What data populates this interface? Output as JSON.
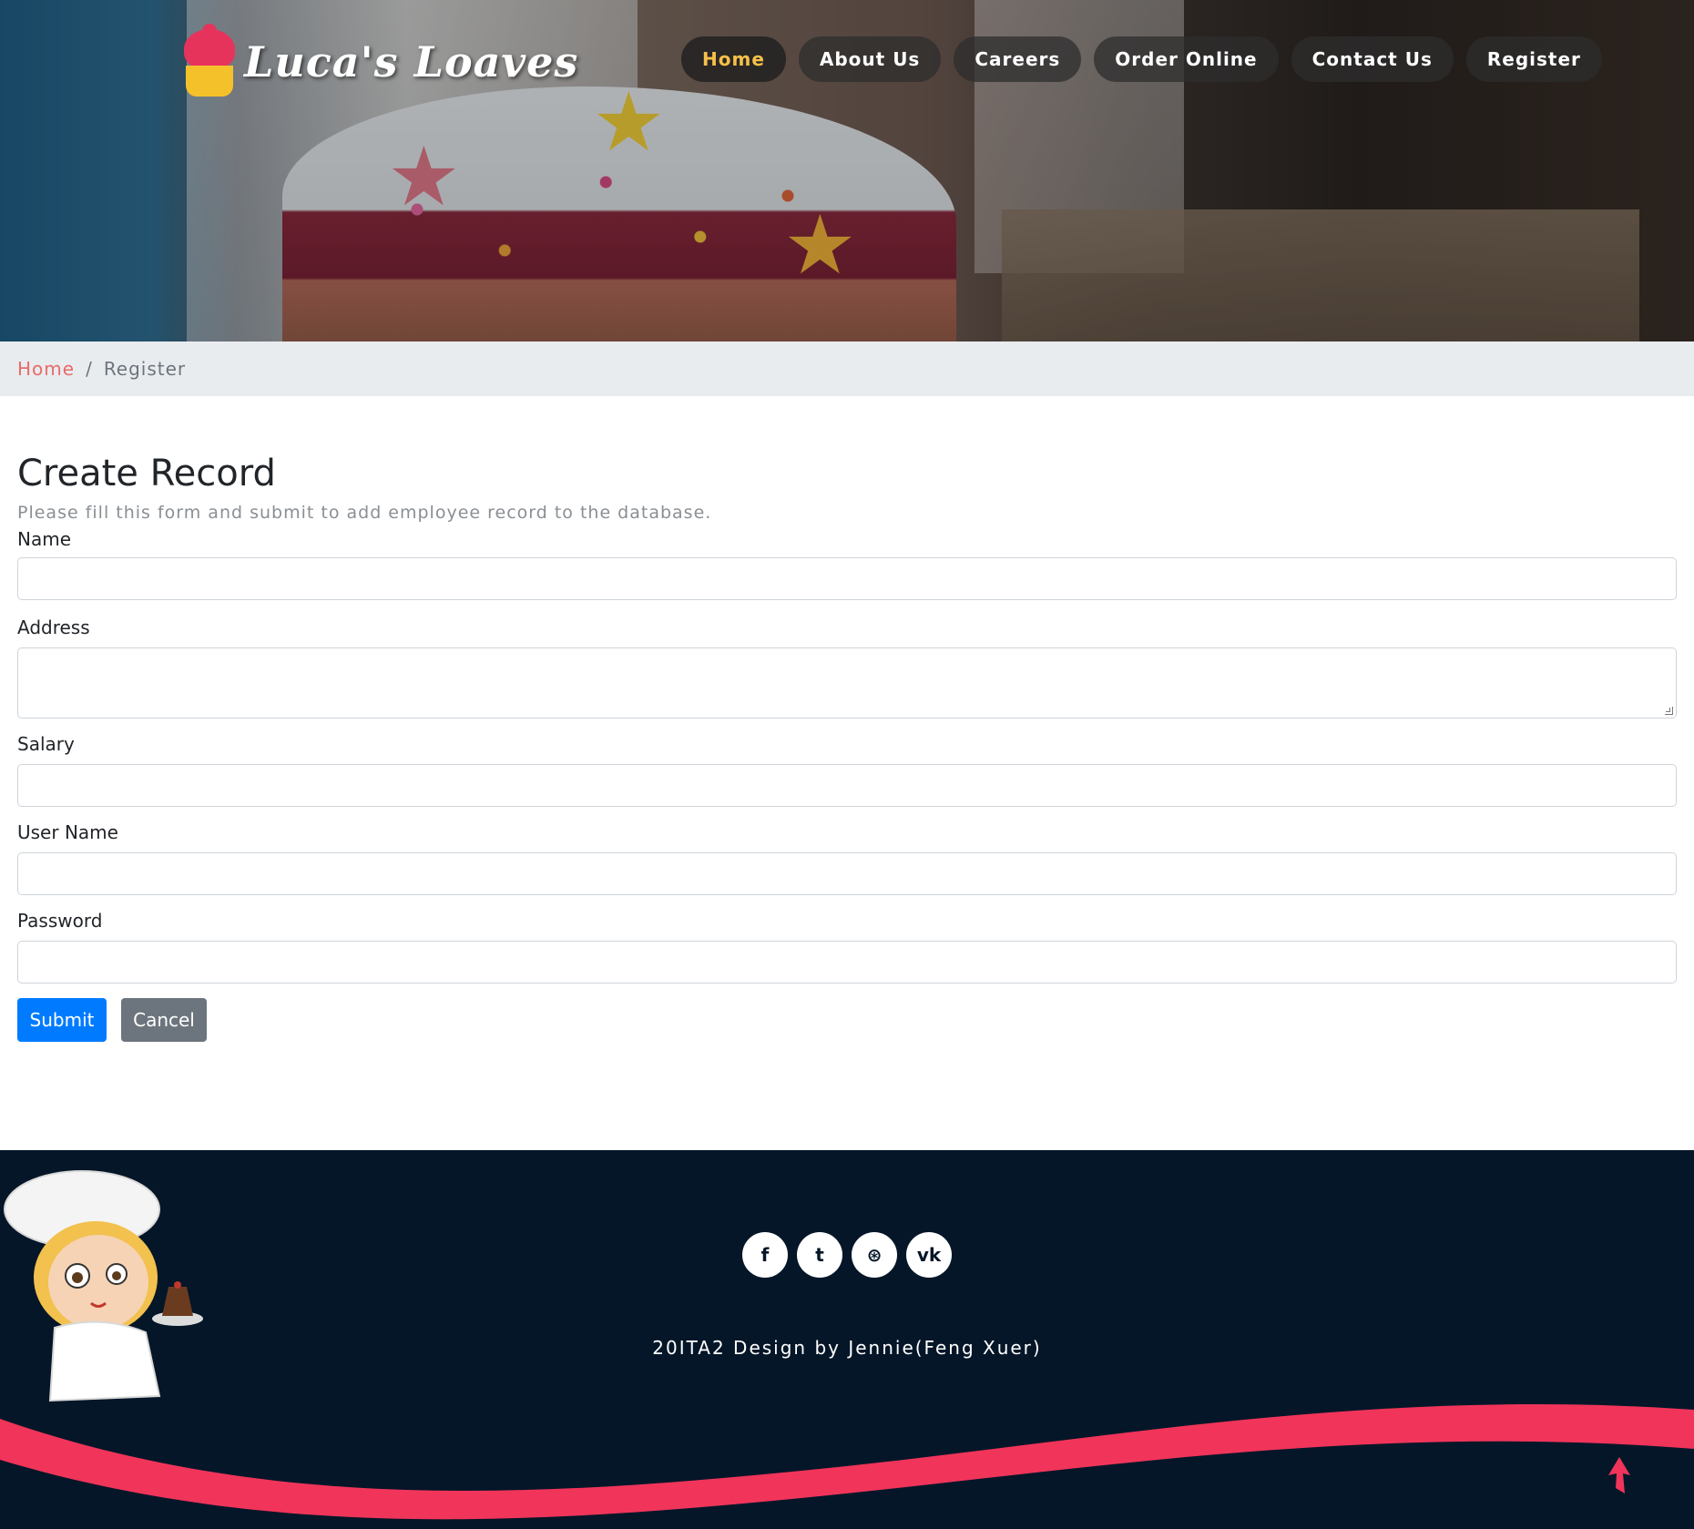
{
  "brand": {
    "name": "Luca's Loaves",
    "logo_icon": "cupcake-icon"
  },
  "nav": {
    "items": [
      {
        "label": "Home",
        "active": true
      },
      {
        "label": "About Us",
        "active": false
      },
      {
        "label": "Careers",
        "active": false
      },
      {
        "label": "Order Online",
        "active": false
      },
      {
        "label": "Contact Us",
        "active": false
      },
      {
        "label": "Register",
        "active": false
      }
    ]
  },
  "breadcrumb": {
    "home": "Home",
    "separator": "/",
    "current": "Register"
  },
  "form": {
    "title": "Create Record",
    "subtitle": "Please fill this form and submit to add employee record to the database.",
    "fields": {
      "name": {
        "label": "Name",
        "value": ""
      },
      "address": {
        "label": "Address",
        "value": ""
      },
      "salary": {
        "label": "Salary",
        "value": ""
      },
      "username": {
        "label": "User Name",
        "value": ""
      },
      "password": {
        "label": "Password",
        "value": ""
      }
    },
    "submit_label": "Submit",
    "cancel_label": "Cancel"
  },
  "footer": {
    "socials": [
      {
        "icon": "facebook-icon",
        "glyph": "f"
      },
      {
        "icon": "twitter-icon",
        "glyph": "t"
      },
      {
        "icon": "dribbble-icon",
        "glyph": "⊛"
      },
      {
        "icon": "vk-icon",
        "glyph": "vk"
      }
    ],
    "credit": "20ITA2 Design by Jennie(Feng Xuer)"
  },
  "colors": {
    "accent": "#f7c04a",
    "link": "#e96b6b",
    "primary_button": "#007bff",
    "secondary_button": "#6c757d",
    "footer_bg": "#041628",
    "wave": "#f0345a"
  }
}
